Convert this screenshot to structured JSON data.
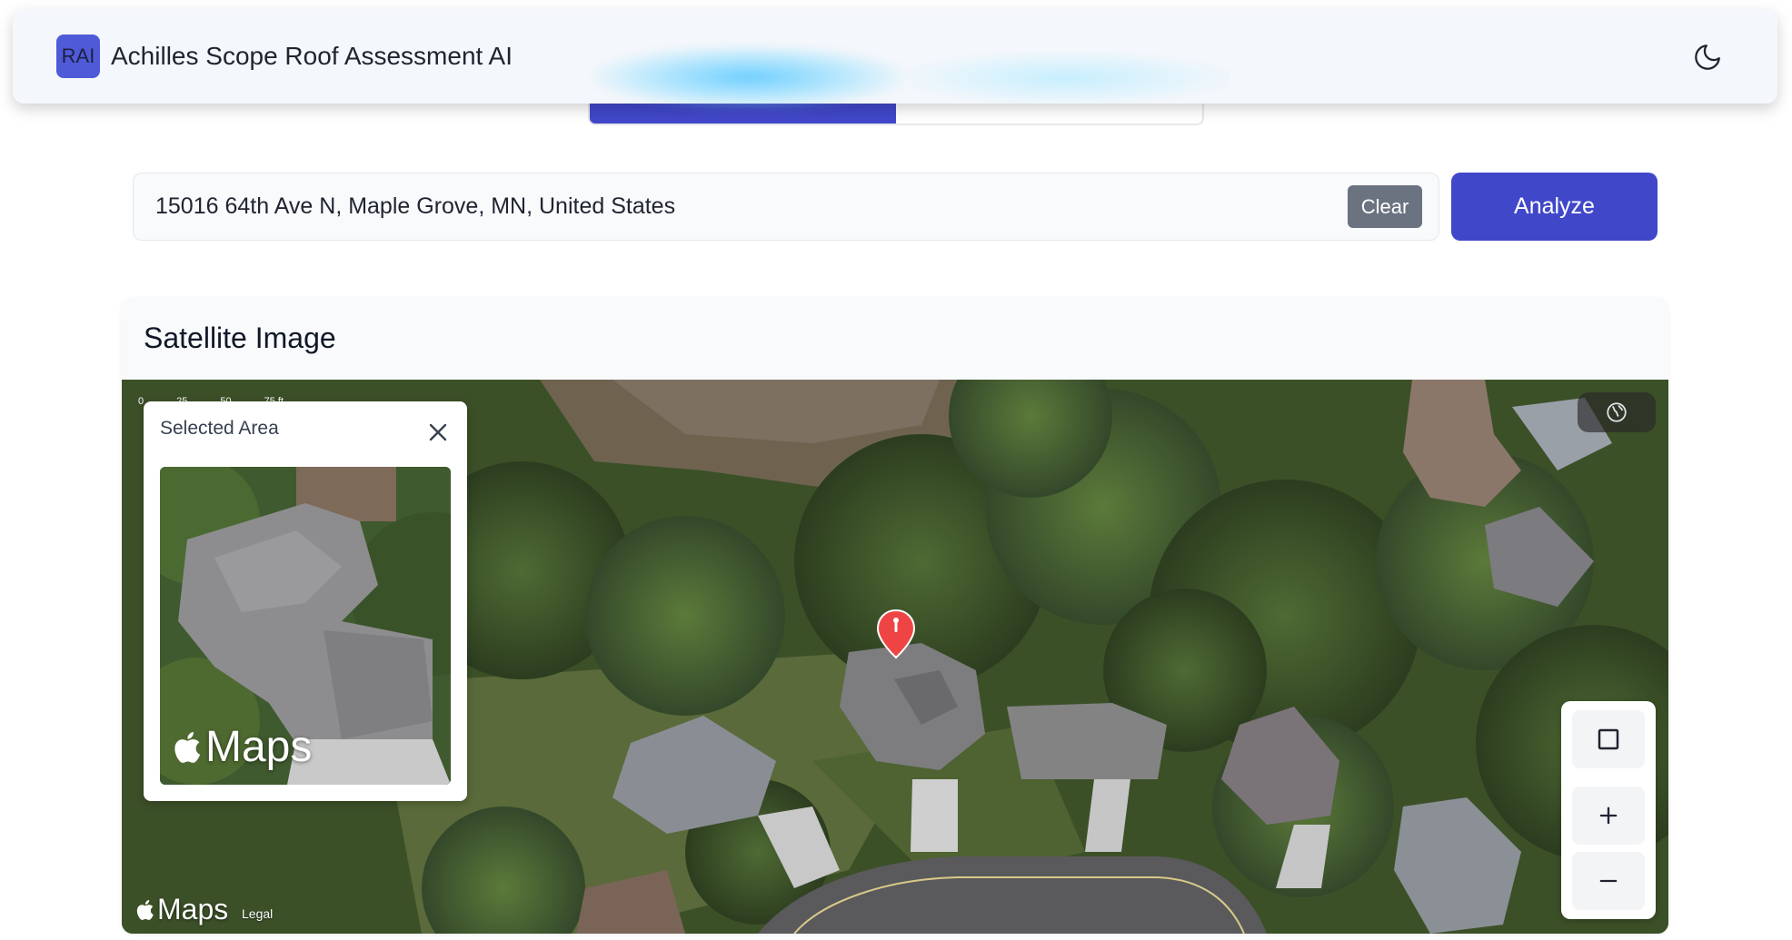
{
  "header": {
    "logo": "RAI",
    "title": "Achilles Scope Roof Assessment AI",
    "theme_icon": "moon-icon"
  },
  "search": {
    "value": "15016 64th Ave N, Maple Grove, MN, United States",
    "clear_label": "Clear",
    "analyze_label": "Analyze"
  },
  "satellite": {
    "title": "Satellite Image",
    "popup": {
      "title": "Selected Area",
      "maps_brand": "Maps"
    },
    "map": {
      "maps_brand": "Maps",
      "legal_label": "Legal",
      "scale_labels": [
        "0",
        "25",
        "50",
        "75 ft"
      ]
    }
  },
  "colors": {
    "primary": "#4147c9",
    "clear_button": "#6b7280",
    "pin": "#ef4444"
  }
}
